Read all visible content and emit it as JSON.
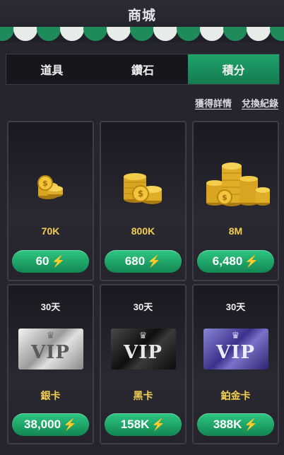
{
  "header": {
    "title": "商城"
  },
  "tabs": [
    {
      "label": "道具",
      "active": false
    },
    {
      "label": "鑽石",
      "active": false
    },
    {
      "label": "積分",
      "active": true
    }
  ],
  "links": {
    "details": "獲得詳情",
    "history": "兌換紀錄"
  },
  "items": [
    {
      "label": "70K",
      "price": "60",
      "icon": "coin-stack-small"
    },
    {
      "label": "800K",
      "price": "680",
      "icon": "coin-stack-medium"
    },
    {
      "label": "8M",
      "price": "6,480",
      "icon": "coin-stack-large"
    },
    {
      "days": "30天",
      "label": "銀卡",
      "price": "38,000",
      "icon": "vip-silver-card"
    },
    {
      "days": "30天",
      "label": "黑卡",
      "price": "158K",
      "icon": "vip-black-card"
    },
    {
      "days": "30天",
      "label": "鉑金卡",
      "price": "388K",
      "icon": "vip-platinum-card"
    }
  ],
  "vip_text": "VIP",
  "currency_icon": "lightning-bolt-icon",
  "colors": {
    "accent_green": "#1fa56c",
    "label_gold": "#f2cf52",
    "bolt_yellow": "#ffd23a"
  }
}
